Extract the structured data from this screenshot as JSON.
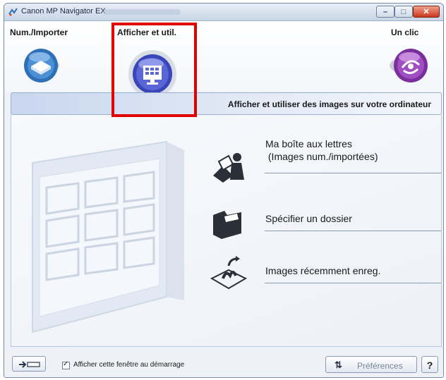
{
  "window": {
    "title": "Canon MP Navigator EX",
    "minimize_glyph": "–",
    "maximize_glyph": "□",
    "close_glyph": "✕"
  },
  "nav": {
    "items": [
      {
        "label": "Num./Importer",
        "icon": "scanner-icon",
        "selected": false
      },
      {
        "label": "Afficher et util.",
        "icon": "monitor-grid-icon",
        "selected": true
      },
      {
        "label": "Un clic",
        "icon": "one-click-icon",
        "selected": false
      }
    ]
  },
  "banner": {
    "text": "Afficher et utiliser des images sur votre ordinateur"
  },
  "actions": [
    {
      "label_line1": "Ma boîte aux lettres",
      "label_line2": " (Images num./importées)",
      "icon": "mailbox-icon"
    },
    {
      "label_line1": "Spécifier un dossier",
      "icon": "folder-icon"
    },
    {
      "label_line1": "Images récemment enreg.",
      "icon": "recent-images-icon"
    }
  ],
  "bottom": {
    "checkbox_label": "Afficher cette fenêtre au démarrage",
    "checkbox_checked": true,
    "preferences_label": "Préférences",
    "preferences_icon": "sort-arrows-icon",
    "help_label": "?",
    "switch_icon": "switch-mode-icon"
  },
  "colors": {
    "selection_border": "#e00000",
    "banner_gradient_start": "#c8d6ee",
    "accent_blue": "#2f6fb6",
    "accent_purple": "#8a3ca8"
  }
}
